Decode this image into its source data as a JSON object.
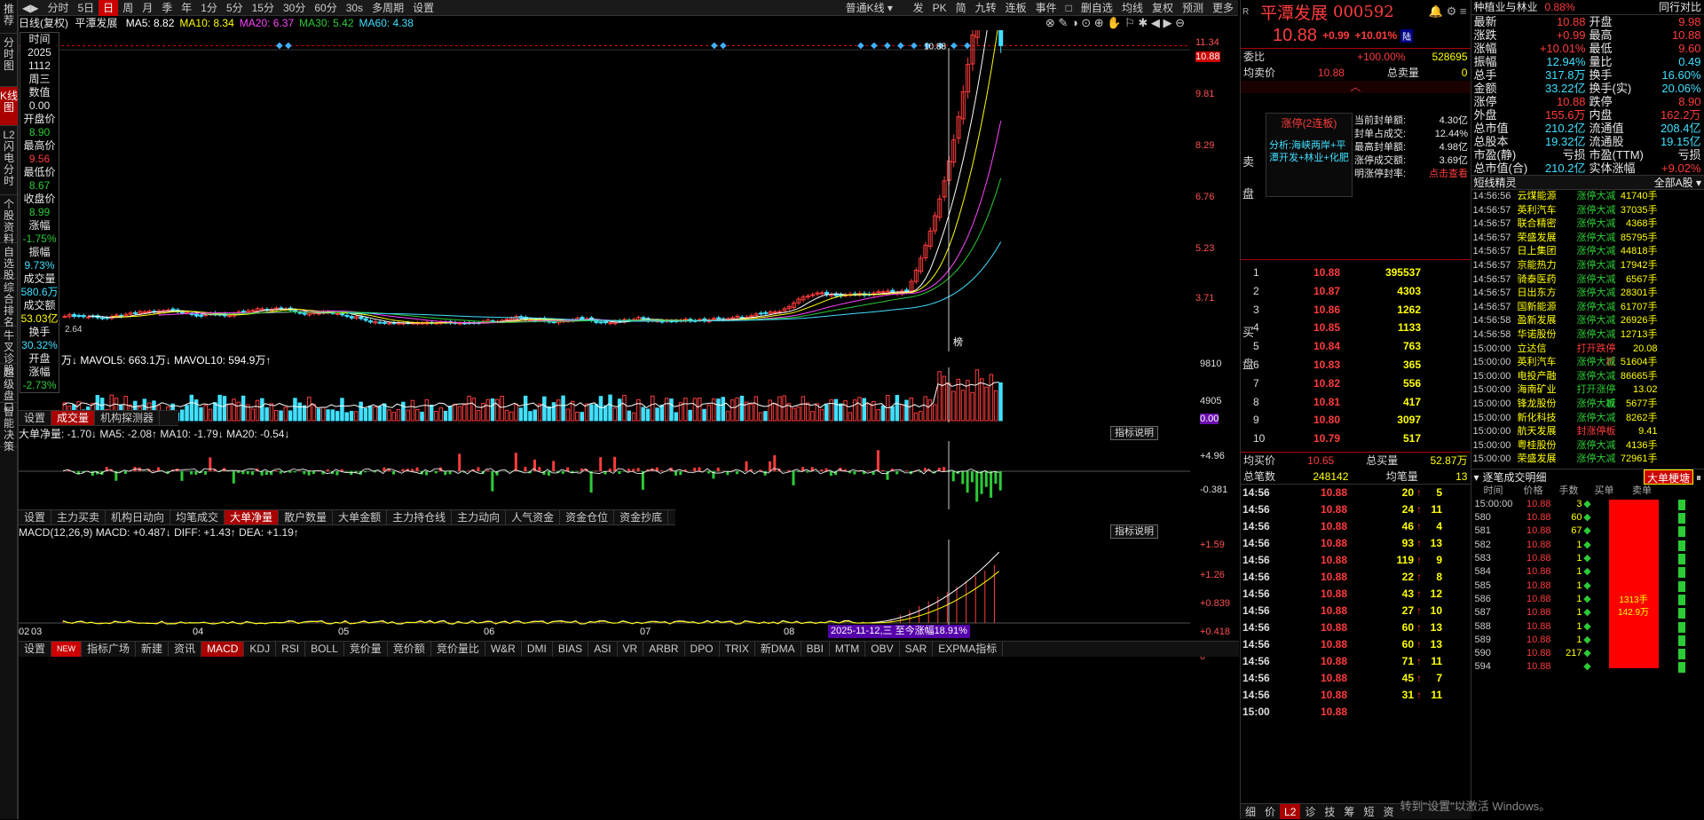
{
  "left_tabs": [
    "推荐",
    "分时图",
    "K线图",
    "L2闪电分时",
    "个股资料",
    "自选股",
    "综合排名",
    "牛叉诊股",
    "超级盘口",
    "智能决策"
  ],
  "left_tabs_active": 2,
  "toolbar": {
    "items": [
      "分时",
      "5日",
      "日",
      "周",
      "月",
      "季",
      "年",
      "1分",
      "5分",
      "15分",
      "30分",
      "60分",
      "30s",
      "多周期",
      "设置"
    ],
    "active": "日",
    "right_items": [
      "普通K线",
      "发",
      "PK",
      "简",
      "九转",
      "连板",
      "事件",
      "□",
      "删自选",
      "均线",
      "复权",
      "预测",
      "更多"
    ]
  },
  "kline": {
    "header_title": "日线(复权)",
    "stock_name": "平潭发展",
    "ma": [
      {
        "label": "MA5: 8.82",
        "color": "#ffffff"
      },
      {
        "label": "MA10: 8.34",
        "color": "#ffff00"
      },
      {
        "label": "MA20: 6.37",
        "color": "#ff44ff"
      },
      {
        "label": "MA30: 5.42",
        "color": "#2ccb36"
      },
      {
        "label": "MA60: 4.38",
        "color": "#40e0ff"
      }
    ],
    "axis": [
      "11.34",
      "10.88",
      "9.81",
      "8.29",
      "6.76",
      "5.23",
      "3.71"
    ],
    "last_price": "10.88",
    "low_label": "2.64",
    "tag": "榜"
  },
  "info_col": [
    {
      "l": "时间",
      "v": "2025"
    },
    {
      "l": "",
      "v": "1112"
    },
    {
      "l": "",
      "v": "周三"
    },
    {
      "l": "数值",
      "v": "0.00"
    },
    {
      "l": "开盘价",
      "v": "8.90",
      "c": "grn"
    },
    {
      "l": "最高价",
      "v": "9.56",
      "c": "red"
    },
    {
      "l": "最低价",
      "v": "8.67",
      "c": "grn"
    },
    {
      "l": "收盘价",
      "v": "8.99",
      "c": "grn"
    },
    {
      "l": "涨幅",
      "v": "-1.75%",
      "c": "grn"
    },
    {
      "l": "振幅",
      "v": "9.73%",
      "c": "cyan"
    },
    {
      "l": "成交量",
      "v": "580.6万",
      "c": "cyan"
    },
    {
      "l": "成交额",
      "v": "53.03亿",
      "c": "yel"
    },
    {
      "l": "换手",
      "v": "30.32%",
      "c": "cyan"
    },
    {
      "l": "开盘",
      "v": ""
    },
    {
      "l": "涨幅",
      "v": "-2.73%",
      "c": "grn"
    }
  ],
  "vol": {
    "header": "万↓ MAVOL5: 663.1万↓ MAVOL10: 594.9万↑",
    "axis": [
      "9810",
      "4905",
      "0.00"
    ]
  },
  "vol_tabs": [
    "设置",
    "成交量",
    "机构探测器"
  ],
  "vol_tab_active": "成交量",
  "bignet": {
    "title": "大单净量",
    "header": "大单净量: -1.70↓ MA5: -2.08↑ MA10: -1.79↓ MA20: -0.54↓",
    "axis": [
      "+4.96",
      "-0.381"
    ],
    "btn": "指标说明"
  },
  "ind_tabs": [
    "设置",
    "主力买卖",
    "机构日动向",
    "均笔成交",
    "大单净量",
    "散户数量",
    "大单金额",
    "主力持仓线",
    "主力动向",
    "人气资金",
    "资金仓位",
    "资金抄底"
  ],
  "ind_tab_active": "大单净量",
  "macd": {
    "header": "MACD(12,26,9) MACD: +0.487↓ DIFF: +1.43↑ DEA: +1.19↑",
    "axis": [
      "+1.59",
      "+1.26",
      "+0.839",
      "+0.418",
      "0"
    ],
    "btn": "指标说明",
    "highlight": "2025-11-12,三 至今涨幅18.91%"
  },
  "x_labels": [
    "02",
    "03",
    "04",
    "05",
    "06",
    "07",
    "08",
    "09"
  ],
  "bottom_tabs": [
    "设置",
    "NEW",
    "指标广场",
    "新建",
    "资讯",
    "MACD",
    "KDJ",
    "RSI",
    "BOLL",
    "竞价量",
    "竞价额",
    "竞价量比",
    "W&R",
    "DMI",
    "BIAS",
    "ASI",
    "VR",
    "ARBR",
    "DPO",
    "TRIX",
    "新DMA",
    "BBI",
    "MTM",
    "OBV",
    "SAR",
    "EXPMA指标"
  ],
  "bottom_tab_active": "MACD",
  "quote": {
    "name": "平潭发展",
    "code": "000592",
    "price": "10.88",
    "chg": "+0.99",
    "pct": "+10.01%",
    "tag": "陆",
    "weibi_l": "委比",
    "weibi": "+100.00%",
    "weibi_r": "528695",
    "avg_l": "均卖价",
    "avg": "10.88",
    "total_l": "总卖量",
    "total": "0",
    "sell_label": "卖盘",
    "buy_label": "买盘",
    "limit_title": "涨停(2连板)",
    "analysis": "分析:海峡两岸+平潭开发+林业+化肥",
    "limit_info": [
      [
        "当前封单额:",
        "4.30亿"
      ],
      [
        "封单占成交:",
        "12.44%"
      ],
      [
        "最高封单额:",
        "4.98亿"
      ],
      [
        "涨停成交额:",
        "3.69亿"
      ],
      [
        "明涨停封率:",
        "点击查看"
      ]
    ],
    "bids": [
      [
        "1",
        "10.88",
        "395537"
      ],
      [
        "2",
        "10.87",
        "4303"
      ],
      [
        "3",
        "10.86",
        "1262"
      ],
      [
        "4",
        "10.85",
        "1133"
      ],
      [
        "5",
        "10.84",
        "763"
      ],
      [
        "6",
        "10.83",
        "365"
      ],
      [
        "7",
        "10.82",
        "556"
      ],
      [
        "8",
        "10.81",
        "417"
      ],
      [
        "9",
        "10.80",
        "3097"
      ],
      [
        "10",
        "10.79",
        "517"
      ]
    ],
    "avg_buy_l": "均买价",
    "avg_buy": "10.65",
    "total_buy_l": "总买量",
    "total_buy": "52.87万",
    "cnt_l": "总笔数",
    "cnt": "248142",
    "avgv_l": "均笔量",
    "avgv": "13",
    "ticks": [
      [
        "14:56",
        "10.88",
        "20",
        "5"
      ],
      [
        "14:56",
        "10.88",
        "24",
        "11"
      ],
      [
        "14:56",
        "10.88",
        "46",
        "4"
      ],
      [
        "14:56",
        "10.88",
        "93",
        "13"
      ],
      [
        "14:56",
        "10.88",
        "119",
        "9"
      ],
      [
        "14:56",
        "10.88",
        "22",
        "8"
      ],
      [
        "14:56",
        "10.88",
        "43",
        "12"
      ],
      [
        "14:56",
        "10.88",
        "27",
        "10"
      ],
      [
        "14:56",
        "10.88",
        "60",
        "13"
      ],
      [
        "14:56",
        "10.88",
        "60",
        "13"
      ],
      [
        "14:56",
        "10.88",
        "71",
        "11"
      ],
      [
        "14:56",
        "10.88",
        "45",
        "7"
      ],
      [
        "14:56",
        "10.88",
        "31",
        "11"
      ],
      [
        "15:00",
        "10.88",
        "",
        ""
      ]
    ],
    "tabs": [
      "细",
      "价",
      "L2",
      "诊",
      "技",
      "筹",
      "短",
      "资"
    ],
    "tab_active": "L2"
  },
  "stats": {
    "sector": "种植业与林业",
    "sector_pct": "0.88%",
    "sector_btn": "同行对比",
    "rows": [
      [
        "最新",
        "10.88",
        "开盘",
        "9.98"
      ],
      [
        "涨跌",
        "+0.99",
        "最高",
        "10.88"
      ],
      [
        "涨幅",
        "+10.01%",
        "最低",
        "9.60"
      ],
      [
        "振幅",
        "12.94%",
        "量比",
        "0.49"
      ],
      [
        "总手",
        "317.8万",
        "换手",
        "16.60%"
      ],
      [
        "金额",
        "33.22亿",
        "换手(实)",
        "20.06%"
      ],
      [
        "涨停",
        "10.88",
        "跌停",
        "8.90"
      ],
      [
        "外盘",
        "155.6万",
        "内盘",
        "162.2万"
      ],
      [
        "总市值",
        "210.2亿",
        "流通值",
        "208.4亿"
      ],
      [
        "总股本",
        "19.32亿",
        "流通股",
        "19.15亿"
      ],
      [
        "市盈(静)",
        "亏损",
        "市盈(TTM)",
        "亏损"
      ],
      [
        "总市值(合)",
        "210.2亿",
        "实体涨幅",
        "+9.02%"
      ]
    ]
  },
  "jingling": {
    "title": "短线精灵",
    "filter": "全部A股",
    "rows": [
      [
        "14:56:56",
        "云煤能源",
        "涨停大减",
        "41740手"
      ],
      [
        "14:56:57",
        "英利汽车",
        "涨停大减",
        "37035手"
      ],
      [
        "14:56:57",
        "联合精密",
        "涨停大减",
        "4368手"
      ],
      [
        "14:56:57",
        "荣盛发展",
        "涨停大减",
        "85795手"
      ],
      [
        "14:56:57",
        "日上集团",
        "涨停大减",
        "44818手"
      ],
      [
        "14:56:57",
        "京能热力",
        "涨停大减",
        "17942手"
      ],
      [
        "14:56:57",
        "骑泰医药",
        "涨停大减",
        "6567手"
      ],
      [
        "14:56:57",
        "日出东方",
        "涨停大减",
        "28301手"
      ],
      [
        "14:56:57",
        "国新能源",
        "涨停大减",
        "61707手"
      ],
      [
        "14:56:58",
        "盈新发展",
        "涨停大减",
        "26926手"
      ],
      [
        "14:56:58",
        "华诺股份",
        "涨停大减",
        "12713手"
      ],
      [
        "15:00:00",
        "立达信",
        "打开跌停板",
        "20.08"
      ],
      [
        "15:00:00",
        "英利汽车",
        "涨停大减",
        "51604手"
      ],
      [
        "15:00:00",
        "电投产融",
        "涨停大减",
        "86665手"
      ],
      [
        "15:00:00",
        "海南矿业",
        "打开涨停板",
        "13.02"
      ],
      [
        "15:00:00",
        "锋龙股份",
        "涨停大减",
        "5677手"
      ],
      [
        "15:00:00",
        "新化科技",
        "涨停大减",
        "8262手"
      ],
      [
        "15:00:00",
        "航天发展",
        "封涨停板",
        "9.41"
      ],
      [
        "15:00:00",
        "粤桂股份",
        "涨停大减",
        "4136手"
      ],
      [
        "15:00:00",
        "荣盛发展",
        "涨停大减",
        "72961手"
      ]
    ]
  },
  "detail": {
    "title": "逐笔成交明细",
    "btn": "大单梗塘",
    "headers": [
      "时间",
      "价格",
      "手数",
      "买单",
      "卖单"
    ],
    "rows": [
      [
        "15:00:00",
        "10.88",
        "3",
        "",
        ""
      ],
      [
        "580",
        "10.88",
        "60",
        "",
        ""
      ],
      [
        "581",
        "10.88",
        "67",
        "",
        ""
      ],
      [
        "582",
        "10.88",
        "1",
        "",
        ""
      ],
      [
        "583",
        "10.88",
        "1",
        "",
        ""
      ],
      [
        "584",
        "10.88",
        "1",
        "",
        ""
      ],
      [
        "585",
        "10.88",
        "1",
        "",
        ""
      ],
      [
        "586",
        "10.88",
        "1",
        "",
        ""
      ],
      [
        "587",
        "10.88",
        "1",
        "",
        ""
      ],
      [
        "588",
        "10.88",
        "1",
        "",
        ""
      ],
      [
        "589",
        "10.88",
        "1",
        "",
        ""
      ],
      [
        "590",
        "10.88",
        "217",
        "",
        ""
      ],
      [
        "594",
        "10.88",
        "",
        ""
      ]
    ],
    "bar_label1": "1313手",
    "bar_label2": "142.9万"
  },
  "watermark": "转到\"设置\"以激活 Windows。"
}
